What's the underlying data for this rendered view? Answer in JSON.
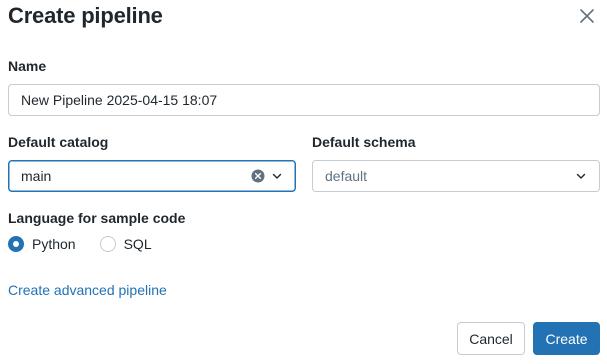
{
  "dialog": {
    "title": "Create pipeline",
    "close_icon": "close-icon"
  },
  "name_field": {
    "label": "Name",
    "value": "New Pipeline 2025-04-15 18:07"
  },
  "catalog_field": {
    "label": "Default catalog",
    "value": "main",
    "clear_icon": "clear-icon",
    "dropdown_icon": "chevron-down-icon"
  },
  "schema_field": {
    "label": "Default schema",
    "placeholder": "default",
    "dropdown_icon": "chevron-down-icon"
  },
  "language": {
    "label": "Language for sample code",
    "options": [
      {
        "label": "Python",
        "selected": true
      },
      {
        "label": "SQL",
        "selected": false
      }
    ]
  },
  "advanced_link": "Create advanced pipeline",
  "footer": {
    "cancel_label": "Cancel",
    "create_label": "Create"
  },
  "colors": {
    "accent": "#2272b4",
    "border": "#c4ccd6",
    "text": "#1f272d",
    "muted": "#5f7281"
  }
}
